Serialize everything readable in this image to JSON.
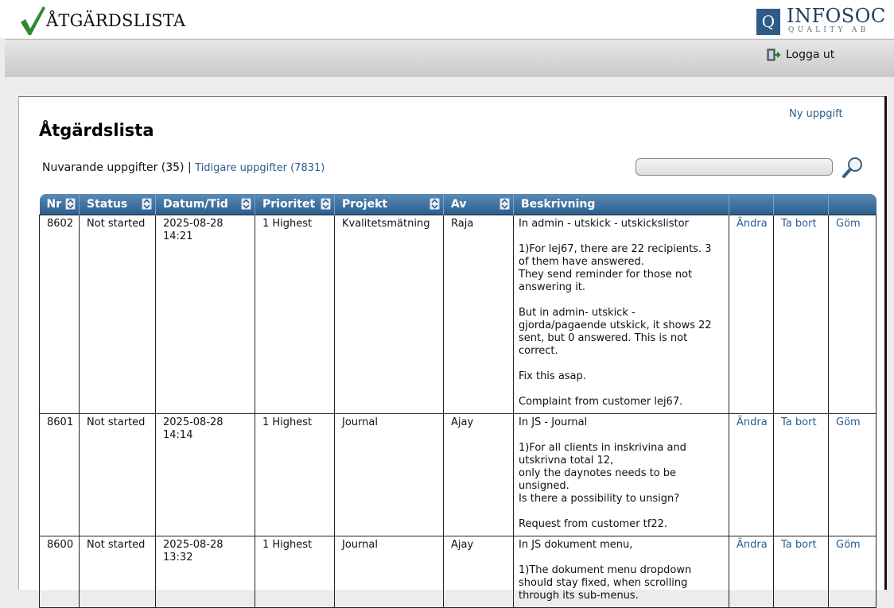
{
  "header": {
    "app_title": "ÅTGÄRDSLISTA",
    "logo_letter": "Q",
    "logo_name": "INFOSOC",
    "logo_sub": "QUALITY AB",
    "logout_label": "Logga ut"
  },
  "page": {
    "new_task_label": "Ny uppgift",
    "title": "Åtgärdslista",
    "current_label": "Nuvarande uppgifter (35)",
    "separator": "|",
    "previous_label": "Tidigare uppgifter (7831)",
    "search_value": ""
  },
  "table": {
    "columns": [
      "Nr",
      "Status",
      "Datum/Tid",
      "Prioritet",
      "Projekt",
      "Av",
      "Beskrivning",
      "",
      "",
      ""
    ],
    "rows": [
      {
        "nr": "8602",
        "status": "Not started",
        "date": "2025-08-28",
        "time": "14:21",
        "priority": "1 Highest",
        "project": "Kvalitetsmätning",
        "by": "Raja",
        "desc": [
          "In admin - utskick - utskickslistor",
          "1)For lej67, there are 22 recipients. 3 of them have answered.\nThey send reminder for those not answering it.",
          "But in admin- utskick - gjorda/pagaende utskick, it shows 22 sent, but 0 answered. This is not correct.",
          "Fix this asap.",
          "Complaint from customer lej67."
        ],
        "edit": "Ändra",
        "delete": "Ta bort",
        "hide": "Göm"
      },
      {
        "nr": "8601",
        "status": "Not started",
        "date": "2025-08-28",
        "time": "14:14",
        "priority": "1 Highest",
        "project": "Journal",
        "by": "Ajay",
        "desc": [
          "In JS - Journal",
          "1)For all clients in inskrivina and utskrivna total 12,\nonly the daynotes needs to be unsigned.\nIs there a possibility to unsign?",
          "Request from customer tf22."
        ],
        "edit": "Ändra",
        "delete": "Ta bort",
        "hide": "Göm"
      },
      {
        "nr": "8600",
        "status": "Not started",
        "date": "2025-08-28",
        "time": "13:32",
        "priority": "1 Highest",
        "project": "Journal",
        "by": "Ajay",
        "desc": [
          "In JS dokument menu,",
          "1)The dokument menu dropdown should stay fixed, when scrolling through its sub-menus."
        ],
        "edit": "Ändra",
        "delete": "Ta bort",
        "hide": "Göm"
      }
    ]
  },
  "colors": {
    "accent": "#2b5f91",
    "link": "#2a5d91",
    "check": "#2e8b2e"
  }
}
